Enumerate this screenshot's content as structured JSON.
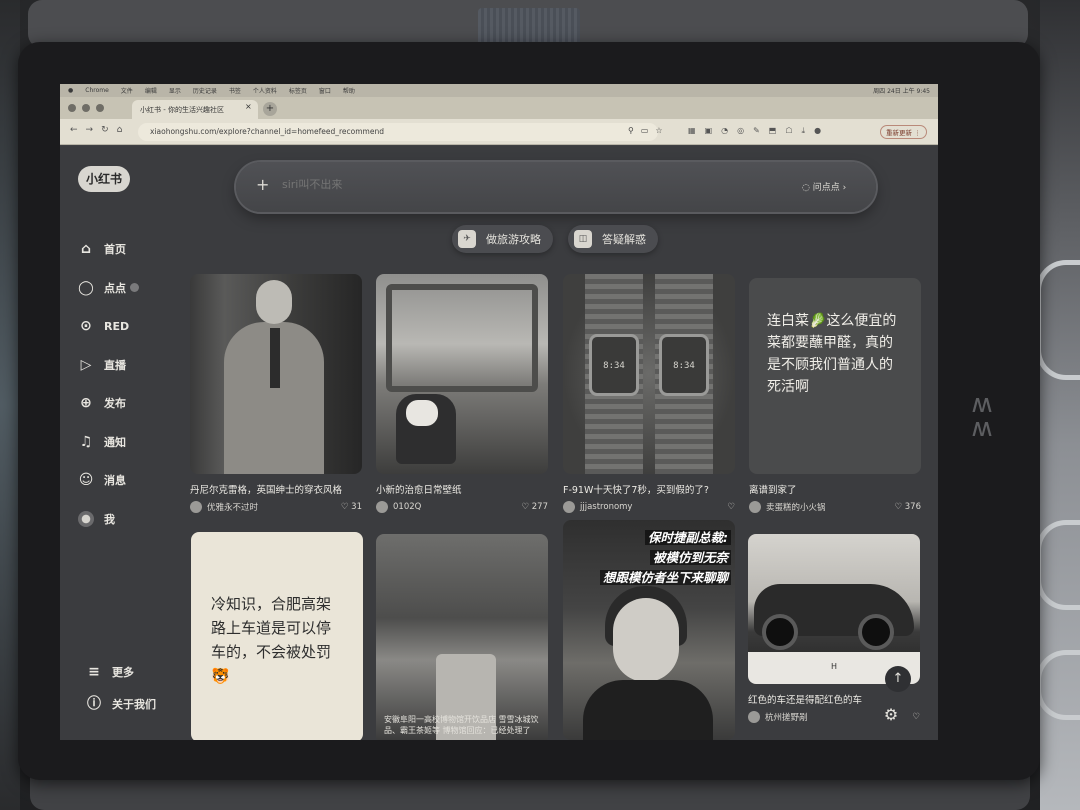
{
  "browser": {
    "mac_menu": [
      "Chrome",
      "文件",
      "编辑",
      "显示",
      "历史记录",
      "书签",
      "个人资料",
      "标签页",
      "窗口",
      "帮助"
    ],
    "status_right": "周四 24日 上午 9:45",
    "tab_title": "小红书 - 你的生活兴趣社区",
    "tab_close": "×",
    "new_tab": "+",
    "url": "xiaohongshu.com/explore?channel_id=homefeed_recommend",
    "relaunch_label": "重新更新 ⋮"
  },
  "app": {
    "brand": "小红书",
    "search": {
      "placeholder": "siri叫不出来",
      "ask_label": "问点点"
    },
    "chips": [
      {
        "label": "做旅游攻略",
        "icon": "travel-icon"
      },
      {
        "label": "答疑解惑",
        "icon": "qa-icon"
      }
    ],
    "sidebar": [
      {
        "label": "首页",
        "icon": "home-icon"
      },
      {
        "label": "点点",
        "icon": "chat-bubble-icon"
      },
      {
        "label": "RED",
        "icon": "play-circle-icon"
      },
      {
        "label": "直播",
        "icon": "live-icon"
      },
      {
        "label": "发布",
        "icon": "plus-square-icon"
      },
      {
        "label": "通知",
        "icon": "bell-icon"
      },
      {
        "label": "消息",
        "icon": "message-icon"
      },
      {
        "label": "我",
        "icon": "avatar-icon"
      }
    ],
    "sidebar_bottom": [
      {
        "label": "更多",
        "icon": "menu-icon"
      },
      {
        "label": "关于我们",
        "icon": "info-icon"
      }
    ],
    "feed": [
      {
        "title": "丹尼尔克雷格，英国绅士的穿衣风格",
        "author": "优雅永不过时",
        "likes": "31"
      },
      {
        "title": "小新的治愈日常壁纸",
        "author": "0102Q",
        "likes": "277"
      },
      {
        "title": "F-91W十天快了7秒，买到假的了?",
        "author": "jjjastronomy",
        "likes": "",
        "watch_time": "8:34"
      },
      {
        "title": "离谱到家了",
        "author": "卖蛋糕的小火锅",
        "likes": "376",
        "cover_text": "连白菜🥬这么便宜的菜都要蘸甲醛，真的是不顾我们普通人的死活啊"
      },
      {
        "cover_text": "冷知识，合肥高架路上车道是可以停车的，不会被处罚🐯"
      },
      {
        "cover_caption": "安徽阜阳一高校博物馆开饮品店 雪雪冰城饮品、霸王茶姬等 博物馆回应：已经处理了"
      },
      {
        "cover_text_lines": [
          "保时捷副总裁:",
          "被模仿到无奈",
          "想跟模仿者坐下来聊聊"
        ]
      },
      {
        "title": "红色的车还是得配红色的车",
        "author": "杭州搓野剐",
        "plate": "H"
      }
    ],
    "fab_up": "↑",
    "fab_gear": "⚙"
  }
}
